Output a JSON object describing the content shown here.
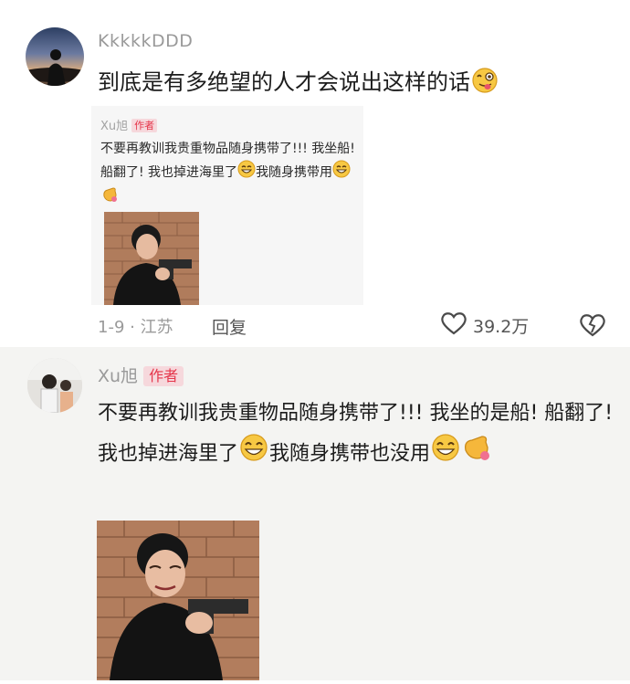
{
  "comment1": {
    "username": "KkkkkDDD",
    "text": "到底是有多绝望的人才会说出这样的话",
    "quote": {
      "username": "Xu旭",
      "author_badge": "作者",
      "text": "不要再教训我贵重物品随身携带了!!! 我坐船! 船翻了! 我也掉进海里了",
      "text_after_emoji": "我随身携带用"
    },
    "date_location": "1-9 · 江苏",
    "reply_label": "回复",
    "likes": "39.2万"
  },
  "comment2": {
    "username": "Xu旭",
    "author_badge": "作者",
    "text": "不要再教训我贵重物品随身携带了!!! 我坐的是船! 船翻了! 我也掉进海里了",
    "text_after_emoji": "我随身携带也没用"
  },
  "icons": {
    "like": "heart-outline-icon",
    "dislike": "broken-heart-icon",
    "emoji_tongue": "tongue-face-emoji-icon",
    "emoji_grin": "grin-emoji-icon",
    "emoji_hand": "waving-hand-emoji-icon"
  },
  "colors": {
    "badge_bg": "#f6d8dc",
    "badge_text": "#e5364b",
    "meta": "#9a9a9a"
  }
}
